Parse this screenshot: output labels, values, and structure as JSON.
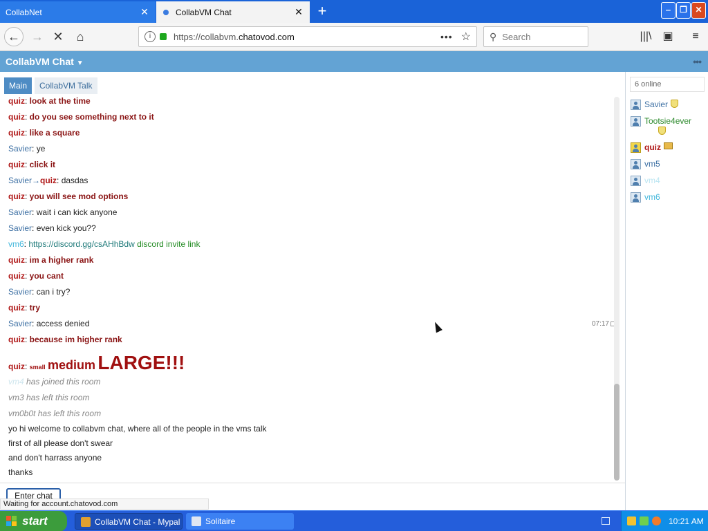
{
  "browser": {
    "tabs": [
      {
        "title": "CollabNet",
        "close": "✕"
      },
      {
        "title": "CollabVM Chat",
        "close": "✕"
      }
    ],
    "new_tab": "+",
    "window_buttons": {
      "minimize": "‒",
      "maximize": "❐",
      "close": "✕"
    },
    "nav": {
      "back": "←",
      "forward": "→",
      "stop": "✕",
      "home": "⌂"
    },
    "url": {
      "scheme": "https://collabvm.",
      "host": "chatovod.com",
      "info": "i",
      "more": "•••",
      "bookmark": "☆"
    },
    "search": {
      "placeholder": "Search",
      "icon": "⚲"
    },
    "toolbar_right": {
      "library": "|||\\",
      "sidebar": "▣",
      "menu": "≡"
    }
  },
  "chat": {
    "header_title": "CollabVM Chat",
    "header_caret": "▼",
    "header_menu": "•••",
    "rooms": [
      {
        "label": "Main",
        "active": true
      },
      {
        "label": "CollabVM Talk",
        "active": false
      }
    ],
    "messages": [
      {
        "nick": "quiz",
        "text": "look at the time"
      },
      {
        "nick": "quiz",
        "text": "do you see something next to it"
      },
      {
        "nick": "quiz",
        "text": "like a square"
      },
      {
        "nick": "Savier",
        "text": "ye"
      },
      {
        "nick": "quiz",
        "text": "click it"
      },
      {
        "nick": "Savier",
        "arrow": "→",
        "to": "quiz",
        "text": "dasdas"
      },
      {
        "nick": "quiz",
        "text": "you will see mod options"
      },
      {
        "nick": "Savier",
        "text": "wait i can kick anyone"
      },
      {
        "nick": "Savier",
        "text": "even kick you??"
      },
      {
        "nick": "vm6",
        "link": "https://discord.gg/csAHhBdw",
        "text": "discord invite link"
      },
      {
        "nick": "quiz",
        "text": "im a higher rank"
      },
      {
        "nick": "quiz",
        "text": "you cant"
      },
      {
        "nick": "Savier",
        "text": "can i try?"
      },
      {
        "nick": "quiz",
        "text": "try"
      },
      {
        "nick": "Savier",
        "text": "access denied",
        "time": "07:17"
      },
      {
        "nick": "quiz",
        "text": "because im higher rank"
      },
      {
        "nick": "quiz",
        "small": "small",
        "medium": "medium",
        "large": "LARGE!!!"
      }
    ],
    "system": [
      {
        "who": "vm4",
        "text": "has joined this room"
      },
      {
        "who": "vm3",
        "text": "has left this room"
      },
      {
        "who": "vm0b0t",
        "text": "has left this room"
      }
    ],
    "motd": [
      "yo hi welcome to collabvm chat, where all of the people in the vms talk",
      "first of all please don't swear",
      "and don't harrass anyone",
      "thanks"
    ],
    "enter_button": "Enter chat",
    "status": "Waiting for account.chatovod.com"
  },
  "userlist": {
    "online": "6 online",
    "users": [
      {
        "name": "Savier",
        "badge": "shield"
      },
      {
        "name": "Tootsie4ever",
        "badge": "shield"
      },
      {
        "name": "quiz",
        "badge": "crown"
      },
      {
        "name": "vm5"
      },
      {
        "name": "vm4"
      },
      {
        "name": "vm6"
      }
    ]
  },
  "taskbar": {
    "start": "start",
    "tasks": [
      {
        "label": "CollabVM Chat - Mypal"
      },
      {
        "label": "Solitaire"
      }
    ],
    "clock": "10:21 AM"
  },
  "colors": {
    "tabstrip": "#1a63d8",
    "chat_header": "#63a3d4",
    "mod_red": "#b01818",
    "user_blue": "#3c6fa3",
    "taskbar": "#245edb",
    "start_green": "#3c9c3c"
  }
}
